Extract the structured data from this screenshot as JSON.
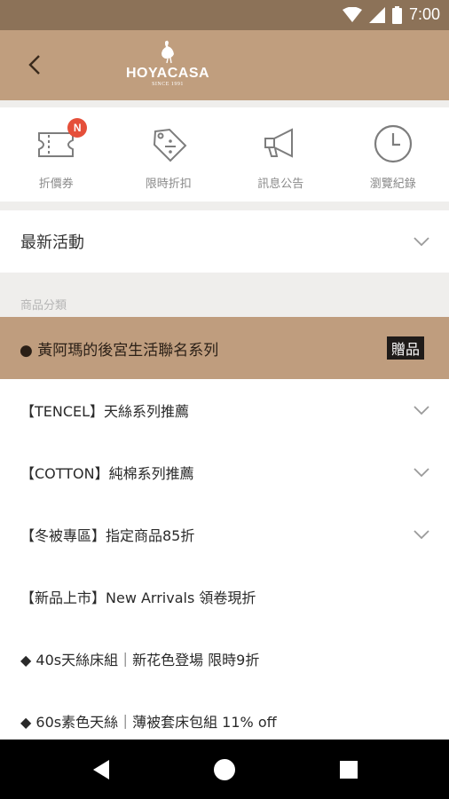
{
  "status_bar": {
    "time": "7:00"
  },
  "app_bar": {
    "logo_name": "HOYACASA",
    "logo_since": "SINCE 1991"
  },
  "quick_menu": {
    "items": [
      {
        "label": "折價券",
        "icon": "coupon-icon",
        "badge": "N"
      },
      {
        "label": "限時折扣",
        "icon": "discount-tag-icon"
      },
      {
        "label": "訊息公告",
        "icon": "megaphone-icon"
      },
      {
        "label": "瀏覽紀錄",
        "icon": "clock-icon"
      }
    ]
  },
  "latest": {
    "label": "最新活動"
  },
  "categories": {
    "header": "商品分類",
    "highlight": {
      "label": "● 黃阿瑪的後宮生活聯名系列",
      "tag": "贈品"
    },
    "items": [
      {
        "label": "【TENCEL】天絲系列推薦",
        "expandable": true
      },
      {
        "label": "【COTTON】純棉系列推薦",
        "expandable": true
      },
      {
        "label": "【冬被專區】指定商品85折",
        "expandable": true
      },
      {
        "label": "【新品上市】New Arrivals 領卷現折",
        "expandable": false
      },
      {
        "label": "◆ 40s天絲床組｜新花色登場 限時9折",
        "expandable": false
      },
      {
        "label": "◆ 60s素色天絲｜薄被套床包組 11% off",
        "expandable": false
      }
    ]
  },
  "colors": {
    "brand_dark": "#8c7258",
    "brand": "#c09e7e",
    "badge": "#e54f3a"
  }
}
